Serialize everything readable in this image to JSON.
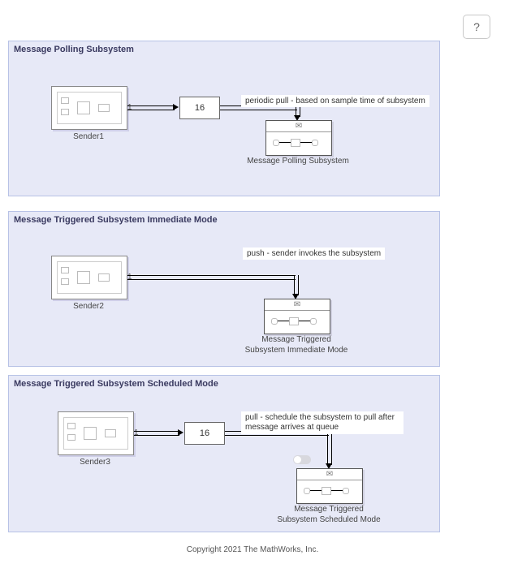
{
  "help_label": "?",
  "copyright": "Copyright 2021 The MathWorks, Inc.",
  "panels": [
    {
      "title": "Message Polling Subsystem",
      "sender_label": "Sender1",
      "port": "1",
      "queue_value": "16",
      "annotation": "periodic pull -  based on sample time of subsystem",
      "subsystem_label": "Message Polling Subsystem"
    },
    {
      "title": "Message Triggered Subsystem Immediate Mode",
      "sender_label": "Sender2",
      "port": "1",
      "queue_value": "",
      "annotation": "push - sender invokes the subsystem",
      "subsystem_label": "Message Triggered\nSubsystem Immediate Mode"
    },
    {
      "title": "Message Triggered Subsystem Scheduled Mode",
      "sender_label": "Sender3",
      "port": "1",
      "queue_value": "16",
      "annotation": "pull - schedule the subsystem to pull after message arrives at queue",
      "subsystem_label": "Message Triggered\nSubsystem Scheduled Mode"
    }
  ]
}
